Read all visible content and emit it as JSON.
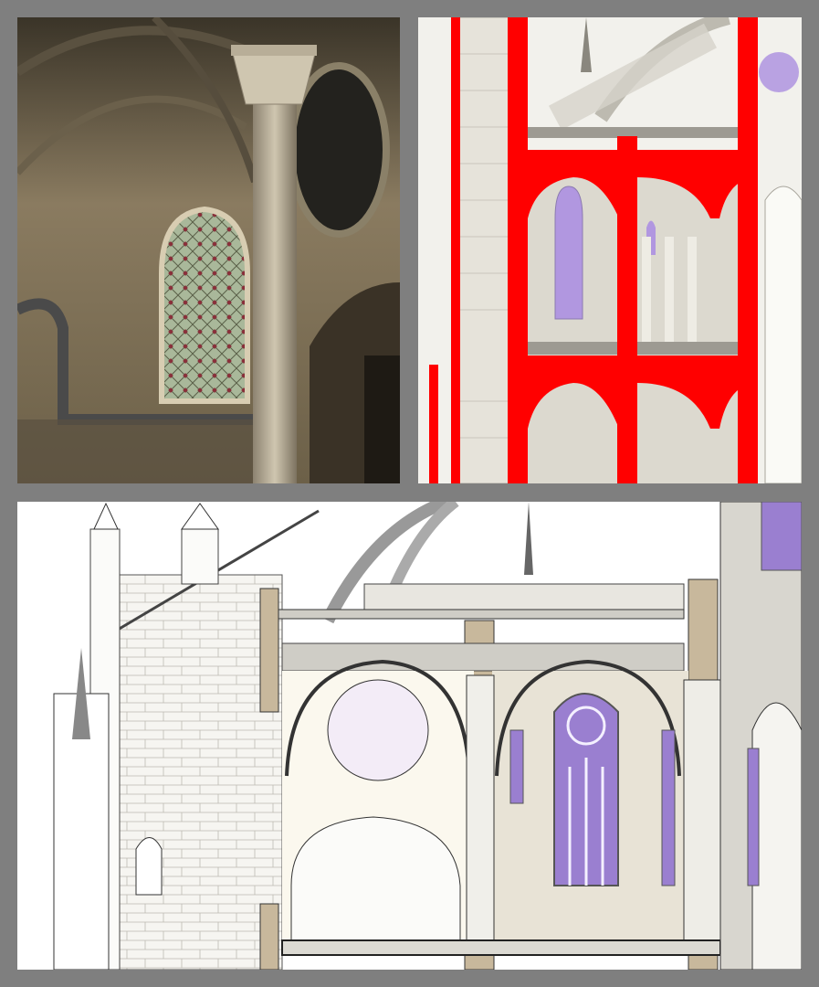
{
  "layout": {
    "background_color": "#7f7f7f",
    "panels": [
      {
        "name": "interior-photo",
        "kind": "photograph of gothic interior with stained glass window and column"
      },
      {
        "name": "section-model-red-cut",
        "kind": "3D sectioned architectural model with red cut planes"
      },
      {
        "name": "elevation-section-drawing",
        "kind": "architectural section drawing of gothic chapel bays"
      }
    ]
  },
  "colors": {
    "cut_plane": "#ff0000",
    "stained_glass": "#9b7fd0",
    "stone": "#e9e6dc",
    "beam": "#c8b89c"
  }
}
